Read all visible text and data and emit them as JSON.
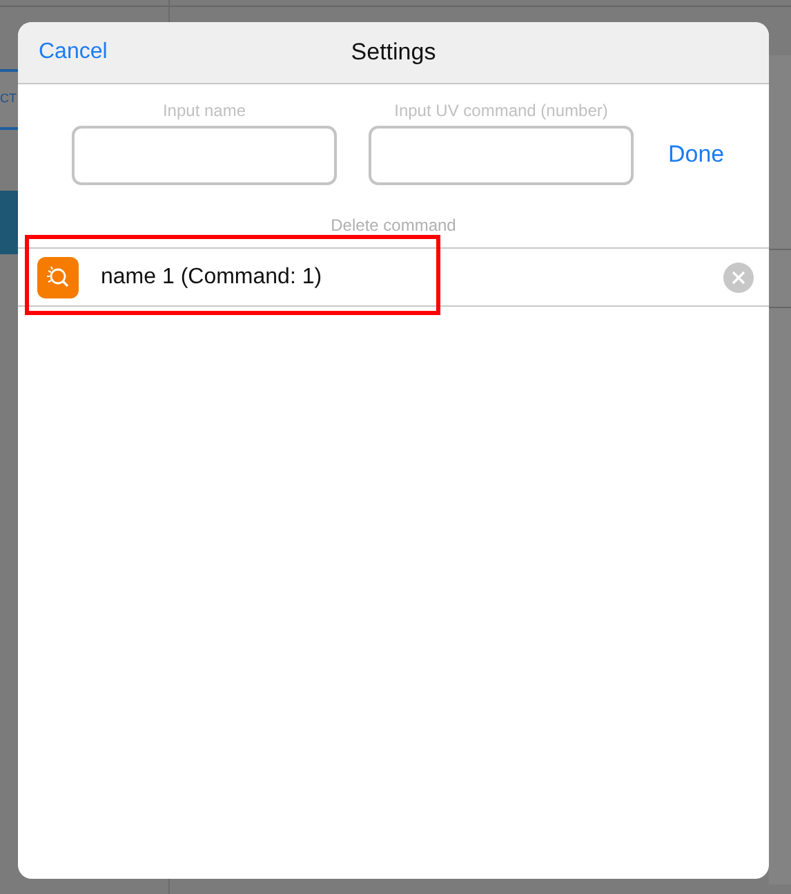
{
  "background": {
    "left_tab": "CT"
  },
  "dialog": {
    "title": "Settings",
    "cancel": "Cancel",
    "done": "Done",
    "fields": [
      {
        "label": "Input name"
      },
      {
        "label": "Input UV command (number)"
      }
    ],
    "section_label": "Delete command",
    "commands": [
      {
        "label": "name 1 (Command: 1)",
        "highlighted": true
      }
    ]
  }
}
